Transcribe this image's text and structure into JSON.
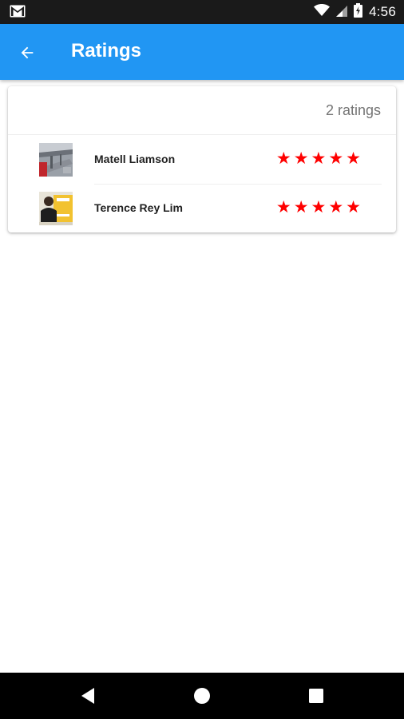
{
  "status_bar": {
    "time": "4:56",
    "icons": [
      "gmail-icon",
      "wifi-icon",
      "signal-icon",
      "battery-icon"
    ]
  },
  "app_bar": {
    "title": "Ratings",
    "back_icon": "arrow-back-icon",
    "color": "#2196f3"
  },
  "ratings": {
    "count_label": "2 ratings",
    "items": [
      {
        "name": "Matell Liamson",
        "stars": 5,
        "max_stars": 5
      },
      {
        "name": "Terence Rey Lim",
        "stars": 5,
        "max_stars": 5
      }
    ],
    "star_color": "#ff0000"
  },
  "nav_bar": {
    "buttons": [
      "back-triangle-icon",
      "home-circle-icon",
      "recents-square-icon"
    ]
  }
}
